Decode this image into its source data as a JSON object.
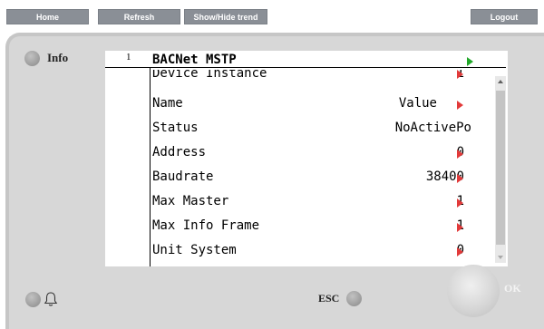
{
  "toolbar": {
    "home_label": "Home",
    "refresh_label": "Refresh",
    "trend_label": "Show/Hide trend",
    "logout_label": "Logout"
  },
  "panel": {
    "info_label": "Info",
    "esc_label": "ESC",
    "ok_label": "OK"
  },
  "screen": {
    "page_number": "1",
    "title": "BACNet MSTP",
    "rows": [
      {
        "label": "Device Instance",
        "value": "1",
        "arrow": true
      },
      {
        "label": "Name",
        "value": "Value",
        "arrow": true
      },
      {
        "label": "Status",
        "value": "NoActivePo",
        "arrow": false
      },
      {
        "label": "Address",
        "value": "0",
        "arrow": true
      },
      {
        "label": "Baudrate",
        "value": "38400",
        "arrow": true
      },
      {
        "label": "Max Master",
        "value": "1",
        "arrow": true
      },
      {
        "label": "Max Info Frame",
        "value": "1",
        "arrow": true
      },
      {
        "label": "Unit System",
        "value": "0",
        "arrow": true
      }
    ]
  },
  "icons": {
    "title_arrow": "green-right-triangle",
    "row_arrow": "red-right-triangle",
    "alarm": "bell-icon"
  },
  "colors": {
    "button_bg": "#8a8f96",
    "panel_bg": "#d7d7d7",
    "arrow_red": "#e23a3a",
    "arrow_green": "#22a82a"
  }
}
